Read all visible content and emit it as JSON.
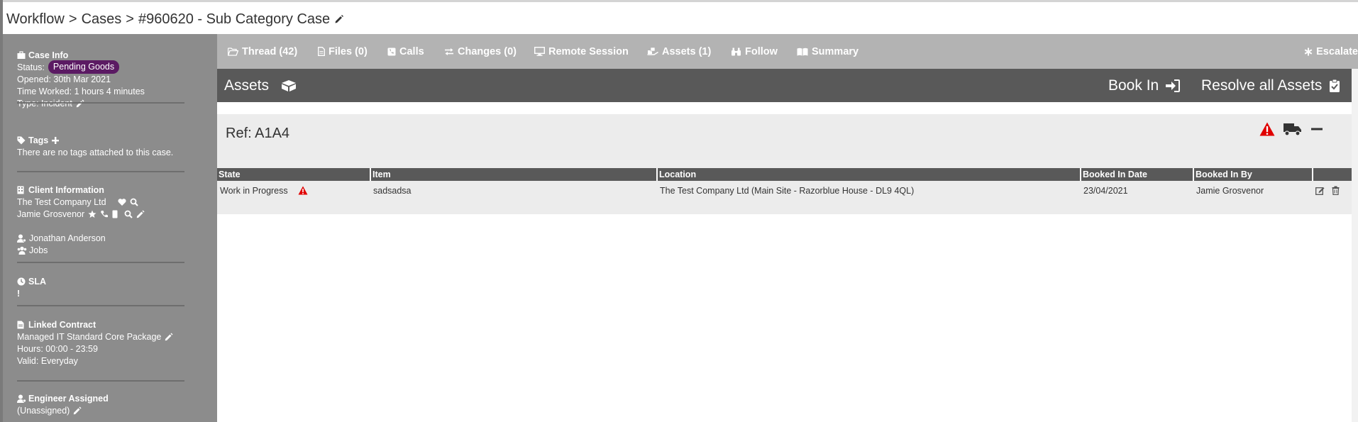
{
  "breadcrumb": {
    "items": [
      "Workflow",
      "Cases",
      "#960620 - Sub Category Case"
    ],
    "separator": ">"
  },
  "sidebar": {
    "case_info": {
      "title": "Case Info",
      "status_label": "Status:",
      "status_value": "Pending Goods",
      "opened": "Opened: 30th Mar 2021",
      "time_worked": "Time Worked: 1 hours 4 minutes",
      "type": "Type: Incident"
    },
    "tags": {
      "title": "Tags",
      "empty_text": "There are no tags attached to this case."
    },
    "client": {
      "title": "Client Information",
      "company": "The Test Company Ltd",
      "contact": "Jamie Grosvenor"
    },
    "people": {
      "user": "Jonathan Anderson",
      "jobs": "Jobs"
    },
    "sla": {
      "title": "SLA",
      "value": "!"
    },
    "contract": {
      "title": "Linked Contract",
      "name": "Managed IT Standard Core Package",
      "hours": "Hours: 00:00 - 23:59",
      "valid": "Valid: Everyday"
    },
    "engineer": {
      "title": "Engineer Assigned",
      "value": "(Unassigned)"
    }
  },
  "tabs": [
    {
      "label": "Thread (42)",
      "icon": "folder-open-icon"
    },
    {
      "label": "Files (0)",
      "icon": "file-icon"
    },
    {
      "label": "Calls",
      "icon": "phone-square-icon"
    },
    {
      "label": "Changes (0)",
      "icon": "exchange-icon"
    },
    {
      "label": "Remote Session",
      "icon": "desktop-icon"
    },
    {
      "label": "Assets (1)",
      "icon": "assets-icon"
    },
    {
      "label": "Follow",
      "icon": "binoculars-icon"
    },
    {
      "label": "Summary",
      "icon": "book-icon"
    }
  ],
  "escalate_label": "Escalate",
  "assets_header": {
    "title": "Assets",
    "book_in": "Book In",
    "resolve_all": "Resolve all Assets"
  },
  "asset": {
    "ref": "Ref: A1A4",
    "columns": [
      "State",
      "Item",
      "Location",
      "Booked In Date",
      "Booked In By",
      ""
    ],
    "rows": [
      {
        "state": "Work in Progress",
        "item": "sadsadsa",
        "location": "The Test Company Ltd (Main Site - Razorblue House - DL9 4QL)",
        "booked_in_date": "23/04/2021",
        "booked_in_by": "Jamie Grosvenor"
      }
    ]
  },
  "colors": {
    "sidebar_bg": "#8c8c8c",
    "tabbar_bg": "#b3b3b3",
    "header_bg": "#595959",
    "badge_bg": "#5b1a63",
    "warning": "#e00000"
  }
}
